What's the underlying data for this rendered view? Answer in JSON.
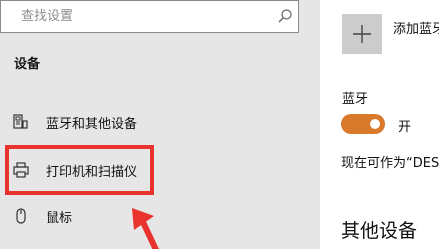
{
  "search": {
    "placeholder": "查找设置"
  },
  "nav": {
    "section_heading": "设备",
    "items": [
      {
        "label": "蓝牙和其他设备",
        "icon": "bluetooth-devices-icon"
      },
      {
        "label": "打印机和扫描仪",
        "icon": "printer-icon"
      },
      {
        "label": "鼠标",
        "icon": "mouse-icon"
      }
    ]
  },
  "main": {
    "add_device_label": "添加蓝牙",
    "bluetooth_heading": "蓝牙",
    "toggle_state": "开",
    "discoverable_text": "现在可作为“DES",
    "other_devices_heading": "其他设备"
  },
  "colors": {
    "nav_bg": "#e6e6e6",
    "toggle_on": "#d97a2b",
    "highlight": "#e8332e"
  }
}
